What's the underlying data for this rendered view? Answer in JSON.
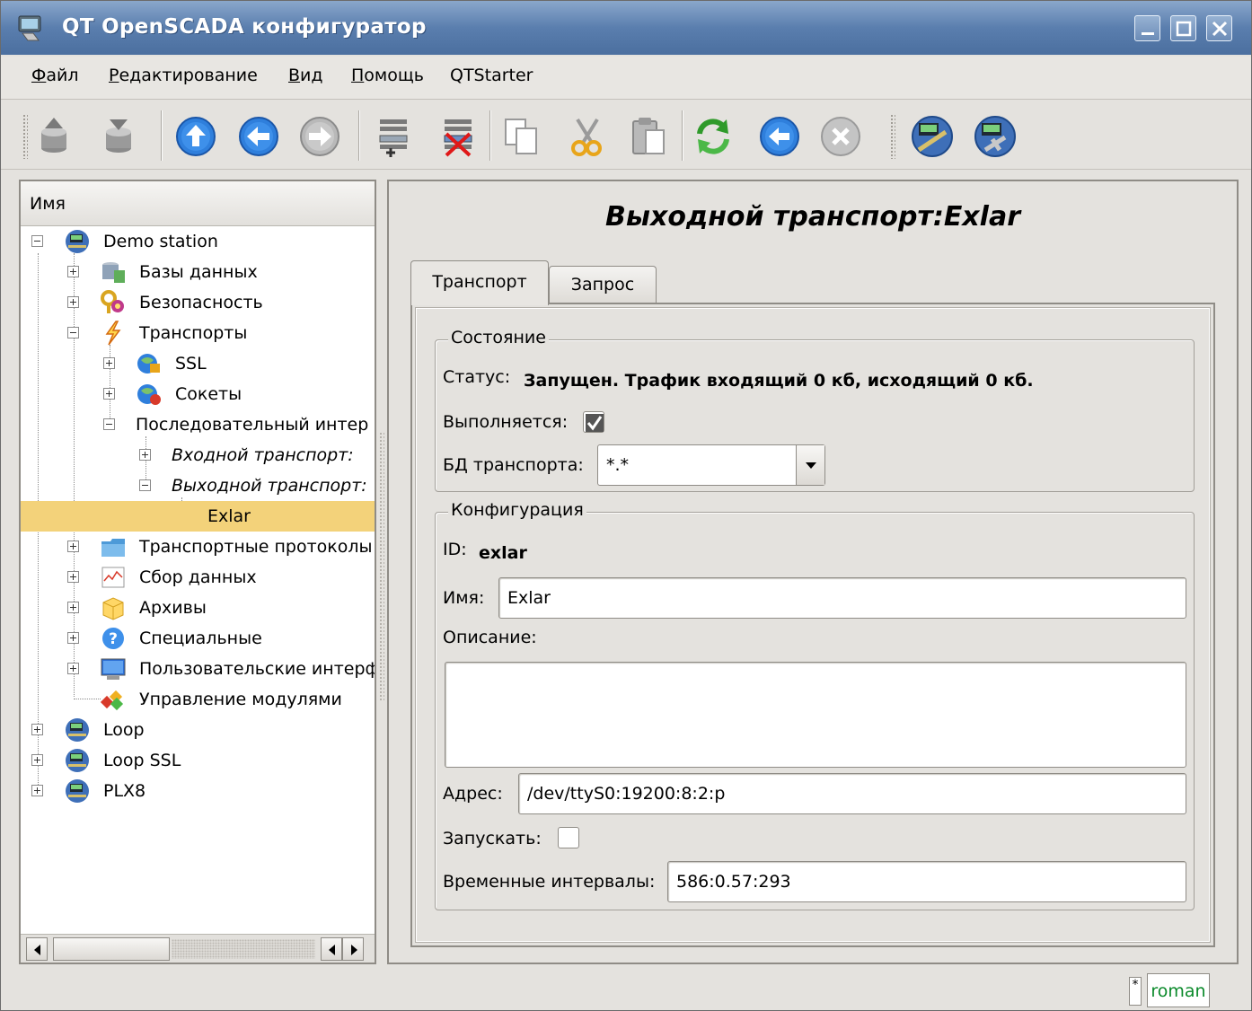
{
  "window": {
    "title": "QT OpenSCADA конфигуратор"
  },
  "menu": [
    {
      "key": "Ф",
      "rest": "айл"
    },
    {
      "key": "Р",
      "rest": "едактирование"
    },
    {
      "key": "В",
      "rest": "ид"
    },
    {
      "key": "П",
      "rest": "омощь"
    },
    {
      "key": "",
      "rest": "QTStarter"
    }
  ],
  "toolbar_icons": [
    "db-load-icon",
    "db-save-icon",
    "up-icon",
    "back-icon",
    "forward-icon",
    "add-item-icon",
    "delete-item-icon",
    "copy-icon",
    "cut-icon",
    "paste-icon",
    "refresh-icon",
    "start-icon",
    "stop-icon",
    "station-icon",
    "station-config-icon"
  ],
  "tree": {
    "header": "Имя",
    "nodes": [
      {
        "label": "Demo station",
        "icon": "station-icon"
      },
      {
        "label": "Базы данных",
        "icon": "database-icon"
      },
      {
        "label": "Безопасность",
        "icon": "security-icon"
      },
      {
        "label": "Транспорты",
        "icon": "transport-icon"
      },
      {
        "label": "SSL",
        "icon": "ssl-icon"
      },
      {
        "label": "Сокеты",
        "icon": "sockets-icon"
      },
      {
        "label": "Последовательный интер",
        "icon": ""
      },
      {
        "label": "Входной транспорт:",
        "icon": ""
      },
      {
        "label": "Выходной транспорт:",
        "icon": ""
      },
      {
        "label": "Exlar",
        "icon": ""
      },
      {
        "label": "Транспортные протоколы",
        "icon": "protocols-icon"
      },
      {
        "label": "Сбор данных",
        "icon": "data-acquisition-icon"
      },
      {
        "label": "Архивы",
        "icon": "archive-icon"
      },
      {
        "label": "Специальные",
        "icon": "special-icon"
      },
      {
        "label": "Пользовательские интерф",
        "icon": "ui-icon"
      },
      {
        "label": "Управление модулями",
        "icon": "modules-icon"
      },
      {
        "label": "Loop",
        "icon": "station-icon"
      },
      {
        "label": "Loop SSL",
        "icon": "station-icon"
      },
      {
        "label": "PLX8",
        "icon": "station-icon"
      }
    ]
  },
  "page": {
    "title": "Выходной транспорт:Exlar",
    "tabs": [
      "Транспорт",
      "Запрос"
    ],
    "state_group": {
      "title": "Состояние",
      "status_label": "Статус:",
      "status_value": "Запущен. Трафик входящий 0 кб, исходящий 0 кб.",
      "running_label": "Выполняется:",
      "running_checked": true,
      "db_label": "БД транспорта:",
      "db_value": "*.*"
    },
    "config_group": {
      "title": "Конфигурация",
      "id_label": "ID:",
      "id_value": "exlar",
      "name_label": "Имя:",
      "name_value": "Exlar",
      "desc_label": "Описание:",
      "desc_value": "",
      "addr_label": "Адрес:",
      "addr_value": "/dev/ttyS0:19200:8:2:p",
      "start_label": "Запускать:",
      "start_checked": false,
      "timeouts_label": "Временные интервалы:",
      "timeouts_value": "586:0.57:293"
    }
  },
  "status": {
    "indicator": "*",
    "user": "roman"
  },
  "colors": {
    "selection": "#f3d27a",
    "user": "#0b8a2b",
    "titlebar": "#5a7eae"
  }
}
